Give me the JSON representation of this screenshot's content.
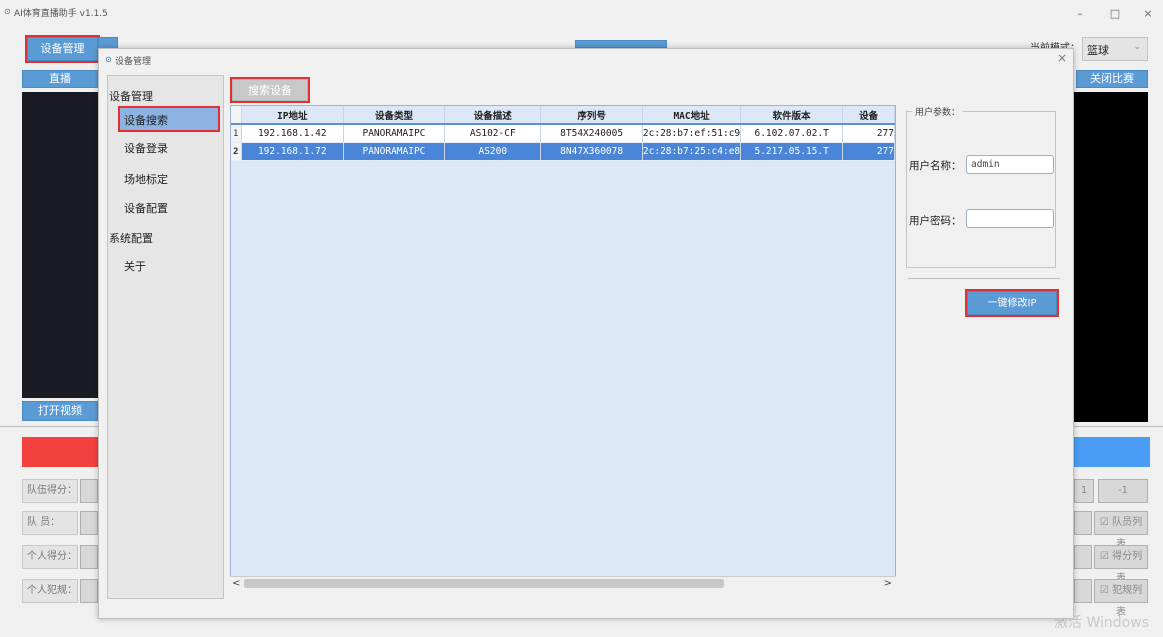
{
  "app": {
    "title": "AI体育直播助手 v1.1.5"
  },
  "window_controls": {
    "minimize": "–",
    "maximize": "□",
    "close": "×"
  },
  "main": {
    "device_mgmt_btn": "设备管理",
    "live_btn": "直播",
    "open_video_btn": "打开视频",
    "mode_label": "当前模式：",
    "mode_value": "篮球",
    "close_match_btn": "关闭比赛",
    "rows": [
      {
        "label": "队伍得分："
      },
      {
        "label": "队  员："
      },
      {
        "label": "个人得分："
      },
      {
        "label": "个人犯规："
      }
    ],
    "minus_one": "-1",
    "one": "1",
    "player_list_btn": "☑ 队员列表",
    "score_list_btn": "☑ 得分列表",
    "foul_list_btn": "☑ 犯规列表"
  },
  "dialog": {
    "title": "设备管理",
    "close": "×",
    "nav": {
      "group1": "设备管理",
      "items": [
        "设备搜索",
        "设备登录",
        "场地标定",
        "设备配置"
      ],
      "group2": "系统配置",
      "about": "关于"
    },
    "search_btn": "搜索设备",
    "table": {
      "columns": [
        "IP地址",
        "设备类型",
        "设备描述",
        "序列号",
        "MAC地址",
        "软件版本",
        "设备"
      ],
      "rows": [
        {
          "num": "1",
          "ip": "192.168.1.42",
          "type": "PANORAMAIPC",
          "desc": "AS102-CF",
          "serial": "8T54X240005",
          "mac": "2c:28:b7:ef:51:c9",
          "version": "6.102.07.02.T",
          "extra": "277"
        },
        {
          "num": "2",
          "ip": "192.168.1.72",
          "type": "PANORAMAIPC",
          "desc": "AS200",
          "serial": "8N47X360078",
          "mac": "2c:28:b7:25:c4:e8",
          "version": "5.217.05.15.T",
          "extra": "277"
        }
      ],
      "scroll_left": "<",
      "scroll_right": ">"
    },
    "user_params": {
      "title": "用户参数：",
      "username_label": "用户名称：",
      "username_value": "admin",
      "password_label": "用户密码：",
      "password_value": ""
    },
    "modify_ip_btn": "一键修改IP"
  },
  "watermark": "激活 Windows",
  "colors": {
    "accent": "#5b9bd5",
    "highlight": "#e03030",
    "selected_row": "#4a85d8",
    "live_bg": "#1a1a24"
  }
}
